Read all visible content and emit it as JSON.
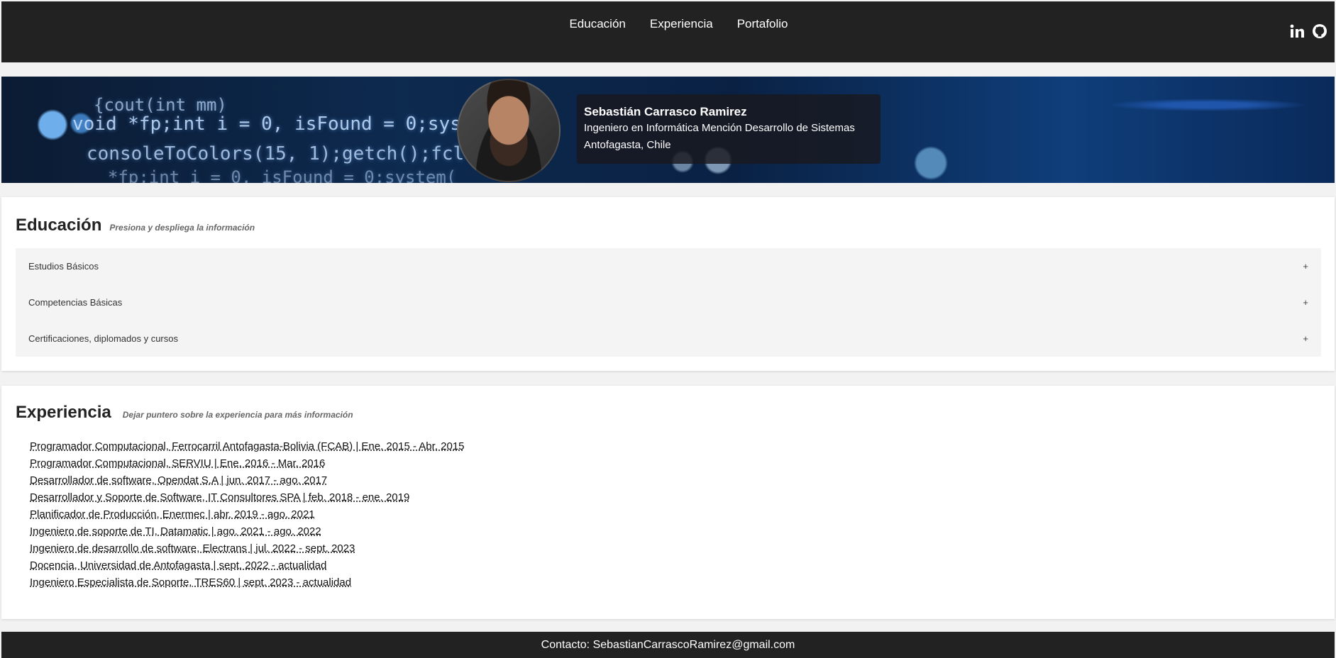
{
  "nav": {
    "links": [
      "Educación",
      "Experiencia",
      "Portafolio"
    ],
    "social": [
      "linkedin-icon",
      "github-icon"
    ]
  },
  "banner": {
    "code_lines": [
      "{cout(int mm)",
      "void *fp;int i = 0, isFound = 0;system",
      "consoleToColors(15, 1);getch();fcl",
      "*fp;int i = 0, isFound = 0;system("
    ]
  },
  "profile": {
    "name": "Sebastián Carrasco Ramirez",
    "title": "Ingeniero en Informática Mención Desarrollo de Sistemas",
    "location": "Antofagasta, Chile"
  },
  "education": {
    "title": "Educación",
    "hint": "Presiona y despliega la información",
    "items": [
      {
        "label": "Estudios Básicos",
        "toggle": "+"
      },
      {
        "label": "Competencias Básicas",
        "toggle": "+"
      },
      {
        "label": "Certificaciones, diplomados y cursos",
        "toggle": "+"
      }
    ]
  },
  "experience": {
    "title": "Experiencia",
    "hint": "Dejar puntero sobre la experiencia para más información",
    "items": [
      "Programador Computacional, Ferrocarril Antofagasta-Bolivia (FCAB) | Ene. 2015 - Abr. 2015",
      "Programador Computacional, SERVIU | Ene. 2016 - Mar. 2016",
      "Desarrollador de software, Opendat S.A | jun. 2017 - ago. 2017",
      "Desarrollador y Soporte de Software, IT Consultores SPA | feb. 2018 - ene. 2019",
      "Planificador de Producción, Enermec | abr. 2019 - ago. 2021",
      "Ingeniero de soporte de TI, Datamatic | ago. 2021 - ago. 2022",
      "Ingeniero de desarrollo de software, Electrans | jul. 2022 - sept. 2023",
      "Docencia, Universidad de Antofagasta | sept. 2022 - actualidad",
      "Ingeniero Especialista de Soporte, TRES60 | sept. 2023 - actualidad"
    ]
  },
  "footer": {
    "contact": "Contacto: SebastianCarrascoRamirez@gmail.com"
  }
}
